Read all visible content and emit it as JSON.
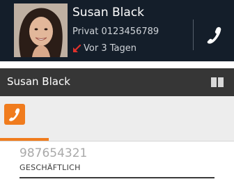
{
  "call_card": {
    "contact_name": "Susan Black",
    "number": "Privat 0123456789",
    "time": "Vor 3 Tagen",
    "call_status_icon": "missed-call-arrow-icon",
    "call_icon": "phone-handset-icon",
    "missed_color": "#e0312b"
  },
  "header": {
    "title": "Susan Black",
    "icon": "contact-book-icon"
  },
  "tabs": {
    "active_icon": "phone-handset-icon",
    "accent_color": "#f07c1e"
  },
  "phone_entry": {
    "value": "987654321",
    "type": "GESCHÄFTLICH"
  }
}
